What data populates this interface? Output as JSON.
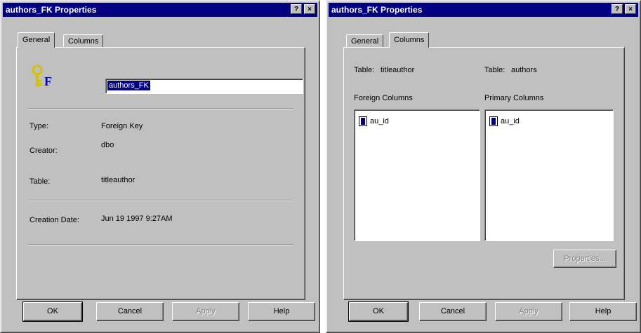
{
  "left_dialog": {
    "title": "authors_FK Properties",
    "help_btn": "?",
    "close_btn": "×",
    "tabs": [
      "General",
      "Columns"
    ],
    "active_tab": "General",
    "name_value": "authors_FK",
    "fields": [
      {
        "label": "Type:",
        "value": "Foreign Key"
      },
      {
        "label": "Creator:",
        "value": "dbo"
      },
      {
        "label": "Table:",
        "value": "titleauthor"
      },
      {
        "label": "Creation Date:",
        "value": "Jun 19 1997  9:27AM"
      }
    ],
    "buttons": {
      "ok": "OK",
      "cancel": "Cancel",
      "apply": "Apply",
      "help": "Help"
    }
  },
  "right_dialog": {
    "title": "authors_FK Properties",
    "help_btn": "?",
    "close_btn": "×",
    "tabs": [
      "General",
      "Columns"
    ],
    "active_tab": "Columns",
    "foreign_table_label": "Table:",
    "foreign_table_value": "titleauthor",
    "primary_table_label": "Table:",
    "primary_table_value": "authors",
    "foreign_columns_label": "Foreign Columns",
    "primary_columns_label": "Primary Columns",
    "foreign_columns": [
      "au_id"
    ],
    "primary_columns": [
      "au_id"
    ],
    "properties_btn": "Properties...",
    "buttons": {
      "ok": "OK",
      "cancel": "Cancel",
      "apply": "Apply",
      "help": "Help"
    }
  },
  "colors": {
    "titlebar": "#000080",
    "face": "#c0c0c0",
    "key_icon": "#d4c000",
    "fk_letter": "#0000c0"
  }
}
